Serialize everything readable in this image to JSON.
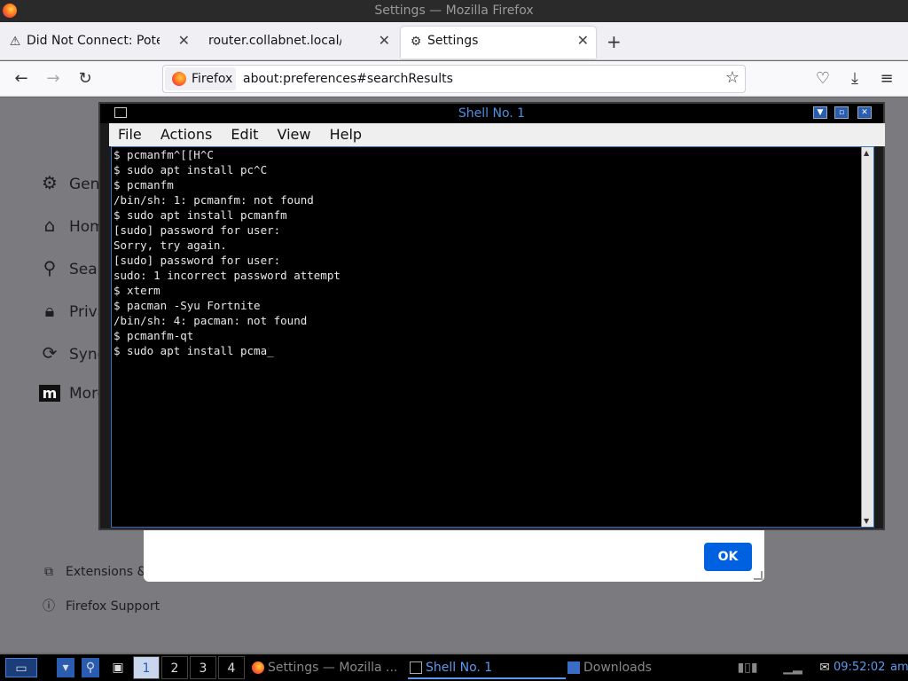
{
  "firefox": {
    "window_title": "Settings — Mozilla Firefox",
    "tabs": [
      {
        "label": "Did Not Connect: Potenti",
        "icon": "warning-icon"
      },
      {
        "label": "router.collabnet.local/",
        "icon": ""
      },
      {
        "label": "Settings",
        "icon": "gear-icon",
        "active": true
      }
    ],
    "identity_label": "Firefox",
    "url": "about:preferences#searchResults"
  },
  "settings": {
    "sidebar": [
      {
        "label": "Gen",
        "icon": "gear-icon"
      },
      {
        "label": "Hom",
        "icon": "home-icon"
      },
      {
        "label": "Sear",
        "icon": "search-icon"
      },
      {
        "label": "Priva",
        "icon": "lock-icon"
      },
      {
        "label": "Sync",
        "icon": "sync-icon"
      },
      {
        "label": "More",
        "icon": "mozilla-icon"
      }
    ],
    "footer_links": [
      {
        "label": "Extensions &",
        "icon": "puzzle-icon"
      },
      {
        "label": "Firefox Support",
        "icon": "help-icon"
      }
    ],
    "dialog_ok": "OK"
  },
  "terminal": {
    "title": "Shell No. 1",
    "menu": [
      "File",
      "Actions",
      "Edit",
      "View",
      "Help"
    ],
    "lines": [
      "$ pcmanfm^[[H^C",
      "$ sudo apt install pc^C",
      "$ pcmanfm",
      "/bin/sh: 1: pcmanfm: not found",
      "$ sudo apt install pcmanfm",
      "[sudo] password for user:",
      "Sorry, try again.",
      "[sudo] password for user:",
      "sudo: 1 incorrect password attempt",
      "$ xterm",
      "$ pacman -Syu Fortnite",
      "/bin/sh: 4: pacman: not found",
      "$ pcmanfm-qt",
      "$ sudo apt install pcma_"
    ]
  },
  "taskbar": {
    "workspaces": [
      "1",
      "2",
      "3",
      "4"
    ],
    "tasks": [
      {
        "label": "Settings — Mozilla ...",
        "icon": "firefox-icon"
      },
      {
        "label": "Shell No. 1",
        "icon": "terminal-icon"
      },
      {
        "label": "Downloads",
        "icon": "folder-icon"
      }
    ],
    "clock": "09:52:02",
    "ampm": "am"
  }
}
